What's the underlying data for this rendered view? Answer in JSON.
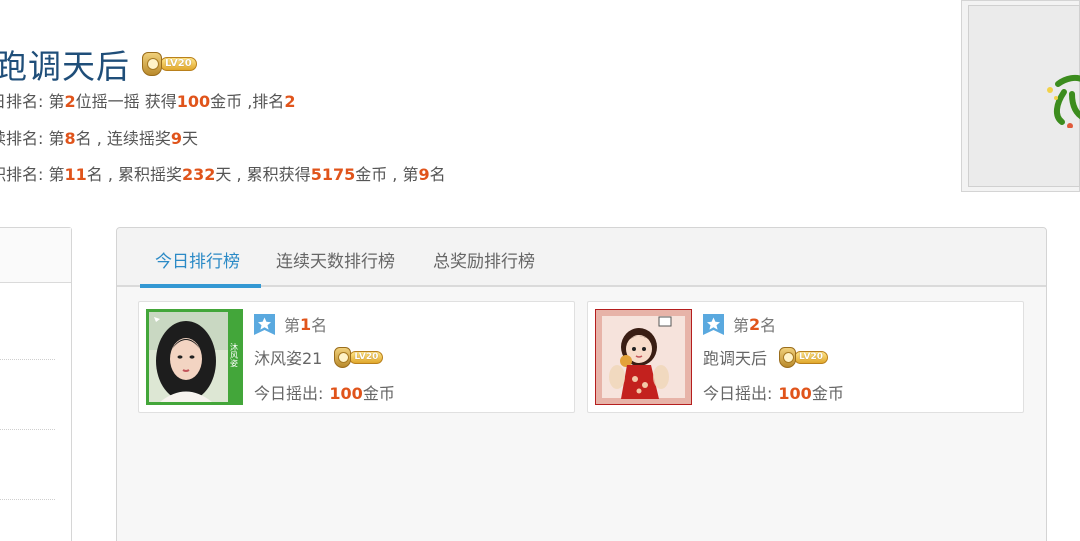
{
  "header": {
    "username": "跑调天后",
    "level_badge": "LV20",
    "today_rank": {
      "prefix": "日排名: 第",
      "rank": "2",
      "mid": "位摇一摇 获得",
      "coins": "100",
      "mid2": "金币 ,排名",
      "rank2": "2"
    },
    "streak_rank": {
      "prefix": "续排名: 第",
      "rank": "8",
      "mid": "名 , 连续摇奖",
      "days": "9",
      "suffix": "天"
    },
    "total_rank": {
      "prefix": "积排名: 第",
      "rank": "11",
      "mid": "名 , 累积摇奖",
      "days": "232",
      "mid2": "天 , 累积获得",
      "coins": "5175",
      "mid3": "金币 , 第",
      "rank2": "9",
      "suffix": "名"
    }
  },
  "tabs": [
    {
      "label": "今日排行榜",
      "active": true
    },
    {
      "label": "连续天数排行榜",
      "active": false
    },
    {
      "label": "总奖励排行榜",
      "active": false
    }
  ],
  "leaderboard": [
    {
      "rank_prefix": "第",
      "rank": "1",
      "rank_suffix": "名",
      "username": "沐风姿21",
      "level_badge": "LV20",
      "coins_label": "今日摇出:",
      "coins": "100",
      "coins_unit": "金币",
      "avatar_caption": "沐风姿"
    },
    {
      "rank_prefix": "第",
      "rank": "2",
      "rank_suffix": "名",
      "username": "跑调天后",
      "level_badge": "LV20",
      "coins_label": "今日摇出:",
      "coins": "100",
      "coins_unit": "金币"
    }
  ],
  "colors": {
    "title": "#1f4e79",
    "highlight": "#e0541b",
    "tab_active": "#2b8ac6",
    "tab_underline": "#3398d3",
    "rank_icon": "#5aa9df",
    "avatar1_frame": "#43a63a",
    "avatar2_frame": "#b51e1e"
  },
  "icons": {
    "rank": "bookmark-star-icon",
    "level": "level-medal-icon"
  }
}
